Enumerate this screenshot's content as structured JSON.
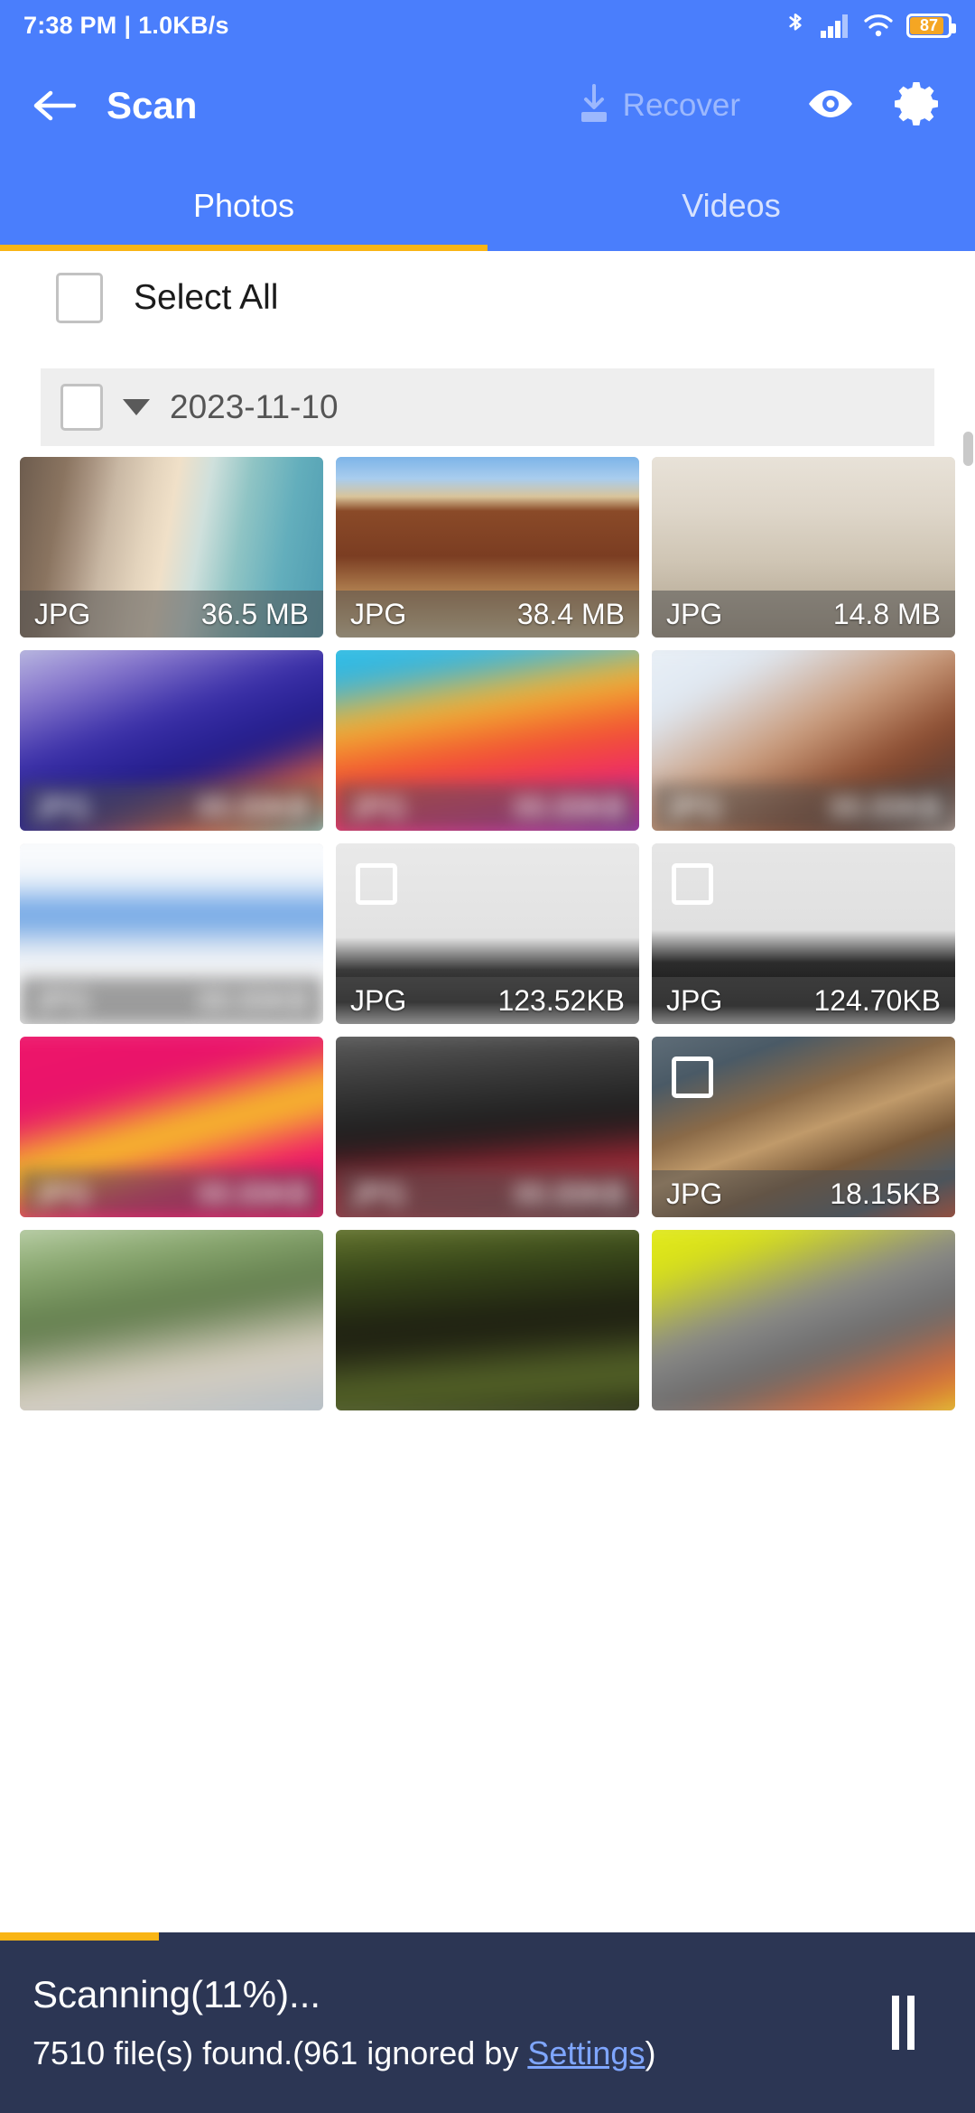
{
  "status_bar": {
    "time": "7:38 PM",
    "separator": "|",
    "network_speed": "1.0KB/s",
    "icons": [
      "bluetooth-icon",
      "cellular-signal-icon",
      "wifi-icon",
      "battery-icon"
    ],
    "battery_percent": "87",
    "background_color": "#4a7efc"
  },
  "app_bar": {
    "back_icon": "back-arrow-icon",
    "title": "Scan",
    "recover_label": "Recover",
    "recover_icon": "download-icon",
    "recover_enabled": false,
    "eye_icon": "eye-icon",
    "settings_icon": "gear-icon",
    "background_color": "#4a7efc"
  },
  "tabs": {
    "items": [
      {
        "label": "Photos",
        "active": true
      },
      {
        "label": "Videos",
        "active": false
      }
    ],
    "indicator_color": "#f9b515"
  },
  "select_all": {
    "label": "Select All",
    "checked": false
  },
  "date_group": {
    "label": "2023-11-10",
    "checked": false,
    "expanded": true,
    "caret_icon": "caret-down-icon"
  },
  "grid": {
    "items": [
      {
        "type": "JPG",
        "size": "36.5 MB",
        "img": "img-beach",
        "blurred": false,
        "checkbox": false,
        "meta": true
      },
      {
        "type": "JPG",
        "size": "38.4 MB",
        "img": "img-canyon",
        "blurred": false,
        "checkbox": false,
        "meta": true
      },
      {
        "type": "JPG",
        "size": "14.8 MB",
        "img": "img-mosque",
        "blurred": false,
        "checkbox": false,
        "meta": true
      },
      {
        "type": "JPG",
        "size": "",
        "img": "img-blur1",
        "blurred": true,
        "checkbox": false,
        "meta": true
      },
      {
        "type": "JPG",
        "size": "",
        "img": "img-blur2",
        "blurred": true,
        "checkbox": false,
        "meta": true
      },
      {
        "type": "JPG",
        "size": "",
        "img": "img-blur3",
        "blurred": true,
        "checkbox": false,
        "meta": true
      },
      {
        "type": "JPG",
        "size": "",
        "img": "img-blur4",
        "blurred": true,
        "checkbox": false,
        "meta": true
      },
      {
        "type": "JPG",
        "size": "123.52KB",
        "img": "img-router1",
        "blurred": false,
        "checkbox": true,
        "meta": true
      },
      {
        "type": "JPG",
        "size": "124.70KB",
        "img": "img-router2",
        "blurred": false,
        "checkbox": true,
        "meta": true
      },
      {
        "type": "JPG",
        "size": "",
        "img": "img-blur5",
        "blurred": true,
        "checkbox": false,
        "meta": true
      },
      {
        "type": "JPG",
        "size": "",
        "img": "img-blur6",
        "blurred": true,
        "checkbox": false,
        "meta": true
      },
      {
        "type": "JPG",
        "size": "18.15KB",
        "img": "img-bbq",
        "blurred": false,
        "checkbox": true,
        "meta": true
      },
      {
        "type": "",
        "size": "",
        "img": "img-blur7",
        "blurred": true,
        "checkbox": false,
        "meta": false
      },
      {
        "type": "",
        "size": "",
        "img": "img-blur8",
        "blurred": true,
        "checkbox": false,
        "meta": false
      },
      {
        "type": "",
        "size": "",
        "img": "img-blur9",
        "blurred": true,
        "checkbox": false,
        "meta": false
      }
    ]
  },
  "bottom_bar": {
    "scan_status": "Scanning(11%)...",
    "progress_percent": 11,
    "found_prefix": "7510 file(s) found.(961 ignored by ",
    "settings_link": "Settings",
    "found_suffix": ")",
    "pause_icon": "pause-icon",
    "background_color": "#2c3654"
  }
}
